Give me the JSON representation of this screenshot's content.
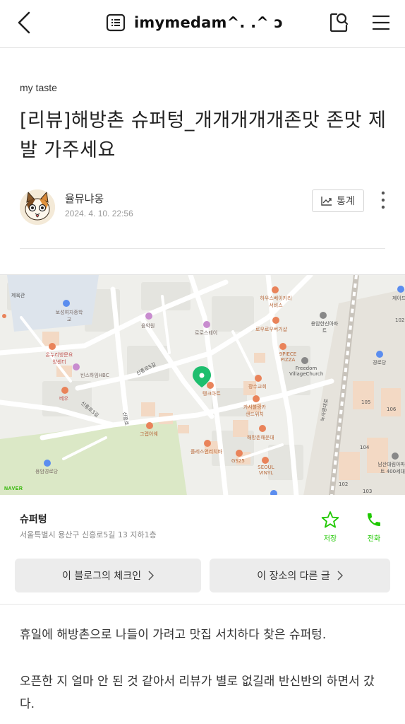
{
  "header": {
    "blog_title": "imymedam^. .^ ɔ"
  },
  "post": {
    "category": "my taste",
    "title": "[리뷰]해방촌 슈퍼텅_개개개개개존맛 존맛 제발 가주세요",
    "author": "율뮤냐옹",
    "date": "2024. 4. 10. 22:56",
    "stats_label": "통계"
  },
  "map": {
    "labels": {
      "l1": "제육관",
      "l2": "보성여자중학교",
      "l3": "음악원",
      "l4": "로로스테이",
      "l5": "하우스베이커리서비스",
      "l6": "로우로우버거샵",
      "l7": "용암한신아파트",
      "l8": "9PIECE PIZZA",
      "l9": "경로당",
      "l10": "온누리방문요양센터",
      "l11": "빈스하임HBC",
      "l12": "베우",
      "l13": "텡크아트",
      "l14": "장수교회",
      "l15": "Freedom VillageChurch",
      "l16": "카사블랑카샌드위치",
      "l17": "그랩어웨",
      "l18": "해방촌해운대",
      "l19": "플레스언리치바",
      "l20": "GS25",
      "l21": "SEOUL VINYL",
      "l22": "용암경로당",
      "l23": "남산대림아파트 400세대",
      "l24": "제이드",
      "l25": "105",
      "l26": "106",
      "l27": "104",
      "l28": "102",
      "l29": "103",
      "l30": "102",
      "road1": "신흥로5길",
      "road2": "신흥로3길",
      "road3": "신흥로",
      "road4": "녹사평대로"
    },
    "provider": "NAVER"
  },
  "place": {
    "name": "슈퍼텅",
    "address": "서울특별시 용산구 신흥로5길 13 지하1층",
    "save_label": "저장",
    "call_label": "전화",
    "blog_checkin_label": "이 블로그의 체크인",
    "place_posts_label": "이 장소의 다른 글"
  },
  "body": {
    "p1": "휴일에 해방촌으로 나들이 가려고 맛집 서치하다 찾은 슈퍼텅.",
    "p2": "오픈한 지 얼마 안 된 것 같아서 리뷰가 별로 없길래 반신반의 하면서 갔다."
  },
  "colors": {
    "accent_green": "#1ec800",
    "map_pin": "#1ebe6e"
  }
}
